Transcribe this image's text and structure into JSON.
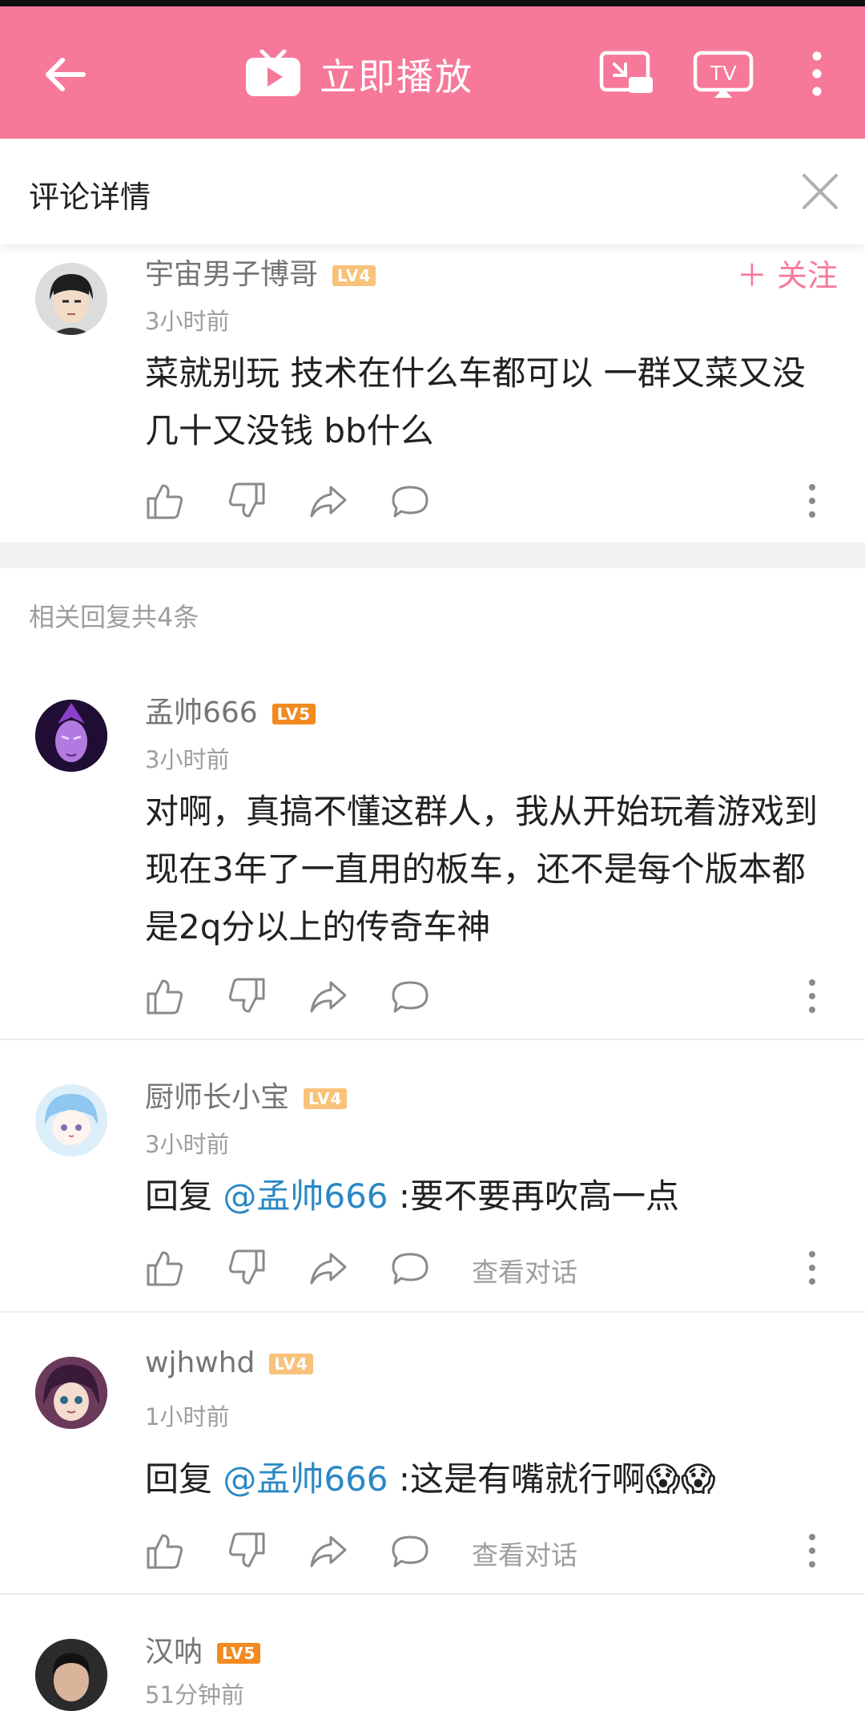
{
  "appbar": {
    "play_label": "立即播放"
  },
  "panel": {
    "title": "评论详情"
  },
  "main_comment": {
    "username": "宇宙男子博哥",
    "level": "LV4",
    "time": "3小时前",
    "content": "菜就别玩 技术在什么车都可以  一群又菜又没几十又没钱 bb什么",
    "follow_label": "＋ 关注"
  },
  "replies_label": "相关回复共4条",
  "replies": [
    {
      "username": "孟帅666",
      "level": "LV5",
      "time": "3小时前",
      "content": "对啊，真搞不懂这群人，我从开始玩着游戏到现在3年了一直用的板车，还不是每个版本都是2q分以上的传奇车神"
    },
    {
      "username": "厨师长小宝",
      "level": "LV4",
      "time": "3小时前",
      "reply_prefix": "回复 ",
      "mention": "@孟帅666",
      "content": " :要不要再吹高一点",
      "view_label": "查看对话"
    },
    {
      "username": "wjhwhd",
      "level": "LV4",
      "time": "1小时前",
      "reply_prefix": "回复 ",
      "mention": "@孟帅666",
      "content": " :这是有嘴就行啊😱😱",
      "view_label": "查看对话"
    },
    {
      "username": "汉呐",
      "level": "LV5",
      "time": "51分钟前"
    }
  ],
  "colors": {
    "accent": "#f6799a",
    "lv4": "#f8c27a",
    "lv5": "#f08a21",
    "mention": "#2a88c4"
  }
}
